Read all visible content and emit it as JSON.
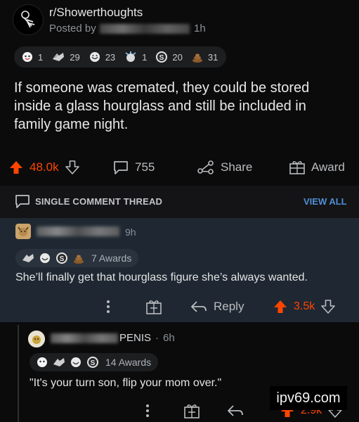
{
  "post": {
    "subreddit": "r/Showerthoughts",
    "posted_by_label": "Posted by",
    "age": "1h",
    "awards": [
      {
        "icon": "wholesome-seal-icon",
        "count": "1"
      },
      {
        "icon": "helpful-hands-icon",
        "count": "29"
      },
      {
        "icon": "face-award-icon",
        "count": "23"
      },
      {
        "icon": "starstruck-icon",
        "count": "1"
      },
      {
        "icon": "silver-icon",
        "count": "20"
      },
      {
        "icon": "poop-icon",
        "count": "31"
      }
    ],
    "title": "If someone was cremated, they could be stored inside a glass hourglass and still be included in family game night.",
    "actions": {
      "upvotes": "48.0k",
      "comments": "755",
      "share_label": "Share",
      "award_label": "Award"
    }
  },
  "thread": {
    "label": "SINGLE COMMENT THREAD",
    "view_all": "VIEW ALL"
  },
  "comment1": {
    "age": "9h",
    "awards_label": "7 Awards",
    "body": "She’ll finally get that hourglass figure she’s always wanted.",
    "reply_label": "Reply",
    "score": "3.5k"
  },
  "comment2": {
    "name_suffix": "PENIS",
    "age": "6h",
    "awards_label": "14 Awards",
    "body": "\"It's your turn son, flip your mom over.\"",
    "score": "2.9k"
  },
  "watermark": "ipv69.com",
  "colors": {
    "upvote": "#ff4500",
    "link": "#4f8fd6",
    "highlight": "#1f2832"
  }
}
